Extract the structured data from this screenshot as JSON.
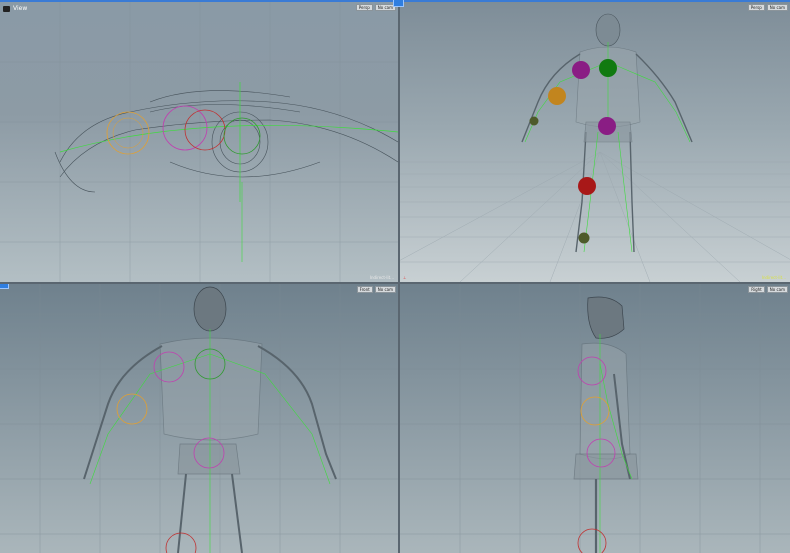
{
  "app": {
    "accent": "#2f7ee0",
    "background": "#3c4650"
  },
  "viewports": {
    "top_left": {
      "label": "View",
      "camera_icon": "camera-icon",
      "buttons": [
        "Persp",
        "No cam"
      ],
      "status": "Indirect-lit..."
    },
    "top_right": {
      "buttons": [
        "Persp",
        "No cam"
      ],
      "status": "Indirect-lit..."
    },
    "bottom_left": {
      "buttons": [
        "Front",
        "No cam"
      ]
    },
    "bottom_right": {
      "buttons": [
        "Right",
        "No cam"
      ]
    }
  },
  "colors": {
    "wireframe": "#46525a",
    "bones": "#3ddc3d",
    "handle_orange": "#e2a030",
    "handle_purple": "#a0209a",
    "handle_green": "#1a8a1a",
    "handle_red": "#c02020",
    "handle_olive": "#4e5a2a",
    "grid": "#7f8c95"
  }
}
